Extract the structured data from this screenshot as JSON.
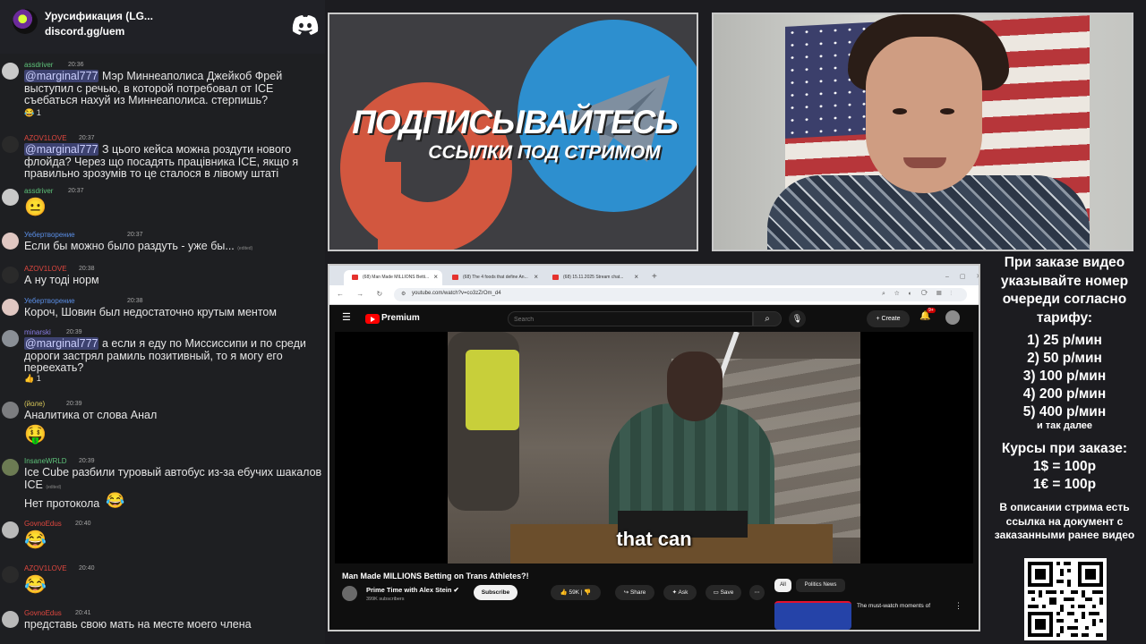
{
  "discord": {
    "title": "Урусификация (LG...",
    "link": "discord.gg/uem"
  },
  "chat": [
    {
      "user": "assdriver",
      "color": "#5ec27a",
      "time": "20:36",
      "mention": "@marginal777",
      "text": "Мэр Миннеаполиса Джейкоб Фрей выступил с речью, в которой потребовал от ICE съебаться нахуй из Миннеаполиса. стерпишь?",
      "reaction": "😂 1"
    },
    {
      "user": "AZOV1LOVE",
      "color": "#e0473f",
      "time": "20:37",
      "mention": "@marginal777",
      "text": "З цього кейса можна роздути нового флойда? Через що посадять працівника ICE, якщо я правильно зрозумів то це сталося в лівому штаті"
    },
    {
      "user": "assdriver",
      "color": "#5ec27a",
      "time": "20:37",
      "emoji": "😐"
    },
    {
      "user": "Уебертворение",
      "color": "#5a8ee6",
      "badge": "UEB",
      "time": "20:37",
      "text": "Если бы можно было раздуть - уже бы...",
      "tag": "(edited)"
    },
    {
      "user": "AZOV1LOVE",
      "color": "#e0473f",
      "time": "20:38",
      "text": "А ну тоді норм"
    },
    {
      "user": "Уебертворение",
      "color": "#5a8ee6",
      "badge": "UEB",
      "time": "20:38",
      "text": "Короч, Шовин был недостаточно крутым ментом"
    },
    {
      "user": "minarski",
      "color": "#8a7ee6",
      "time": "20:39",
      "mention": "@marginal777",
      "text": "а если я еду по Миссиссипи и по среди дороги застрял рамиль позитивный, то я могу его переехать?",
      "reaction": "👍 1"
    },
    {
      "user": "(йоле)",
      "color": "#d8c75a",
      "time": "20:39",
      "text": "Аналитика от слова Анал",
      "emoji": "🤑"
    },
    {
      "user": "InsaneWRLD",
      "color": "#5ec27a",
      "time": "20:39",
      "text": "Ice Cube разбили туровый автобус из-за ебучих шакалов ICE",
      "tag": "(edited)",
      "text2": "Нет протокола",
      "emoji2": "😂"
    },
    {
      "user": "GovnoEdus",
      "color": "#e0473f",
      "time": "20:40",
      "emoji": "😂"
    },
    {
      "user": "AZOV1LOVE",
      "color": "#e0473f",
      "time": "20:40",
      "emoji": "😂"
    },
    {
      "user": "GovnoEdus",
      "color": "#e0473f",
      "time": "20:41",
      "text": "представь свою мать на месте моего члена"
    }
  ],
  "promo": {
    "title": "ПОДПИСЫВАЙТЕСЬ",
    "subtitle": "ССЫЛКИ ПОД СТРИМОМ"
  },
  "browser": {
    "tabs": [
      {
        "label": "(68) Man Made MILLIONS Betti..."
      },
      {
        "label": "(68) The 4 foods that define An..."
      },
      {
        "label": "(68) 15.11.2025 Stream chat..."
      }
    ],
    "url": "youtube.com/watch?v=co3zZrOm_d4"
  },
  "youtube": {
    "brand": "Premium",
    "search_placeholder": "Search",
    "create_label": "Create",
    "notif_count": "9+",
    "caption": "that can",
    "video_title": "Man Made MILLIONS Betting on Trans Athletes?!",
    "channel": "Prime Time with Alex Stein",
    "subscribers": "399K subscribers",
    "subscribe_label": "Subscribe",
    "likes": "59K",
    "share_label": "Share",
    "ask_label": "Ask",
    "save_label": "Save",
    "chip_all": "All",
    "chip_politics": "Politics News",
    "rec_title": "The must-watch moments of"
  },
  "info": {
    "order_lines": "При заказе видео указывайте номер очереди согласно тарифу:",
    "prices": [
      "1) 25 р/мин",
      "2) 50 р/мин",
      "3) 100 р/мин",
      "4) 200 р/мин",
      "5) 400 р/мин"
    ],
    "etc": "и так далее",
    "courses_title": "Курсы при заказе:",
    "course_usd": "1$ = 100р",
    "course_eur": "1€ = 100р",
    "description": "В описании стрима есть ссылка на документ с заказанными ранее видео"
  }
}
